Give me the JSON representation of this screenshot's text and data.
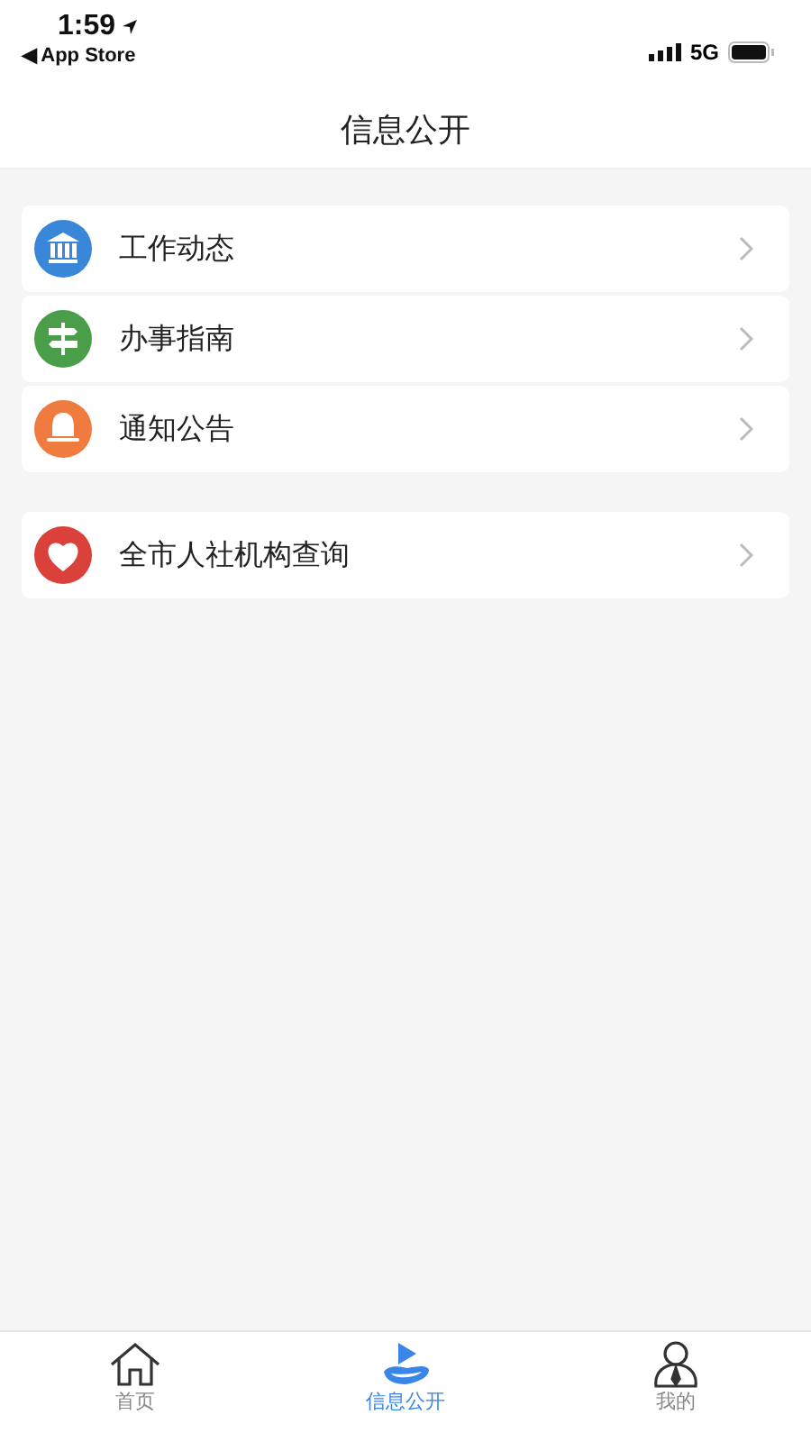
{
  "status_bar": {
    "time": "1:59",
    "back_label": "◀ App Store",
    "network": "5G"
  },
  "nav_bar": {
    "title": "信息公开"
  },
  "groups": [
    {
      "items": [
        {
          "label": "工作动态",
          "kind": "bank",
          "color": "#3a86d8"
        },
        {
          "label": "办事指南",
          "kind": "signpost",
          "color": "#4a9e4a"
        },
        {
          "label": "通知公告",
          "kind": "bell",
          "color": "#ef7b3f"
        }
      ]
    },
    {
      "items": [
        {
          "label": "全市人社机构查询",
          "kind": "heart",
          "color": "#d9413a"
        }
      ]
    }
  ],
  "tab_bar": [
    {
      "label": "首页",
      "kind": "home",
      "selected": false
    },
    {
      "label": "信息公开",
      "kind": "play",
      "selected": true
    },
    {
      "label": "我的",
      "kind": "person",
      "selected": false
    }
  ]
}
